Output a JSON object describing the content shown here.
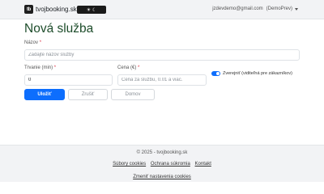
{
  "navbar": {
    "logo_text": "tb",
    "brand": "tvojbooking.sk",
    "theme_toggle_icons": "☀ ☾",
    "user_email": "jzdevdemo@gmail.com",
    "user_role": "(DemoPrev)"
  },
  "page": {
    "title": "Nová služba"
  },
  "form": {
    "name_label": "Názov",
    "name_placeholder": "Zadajte názov služby",
    "name_value": "",
    "duration_label": "Trvanie (min)",
    "duration_value": "0",
    "price_label": "Cena (€)",
    "price_placeholder": "Cena za službu, 0.01 a viac.",
    "price_value": "",
    "required_mark": "*",
    "publish_label": "Zverejniť (viditeľná pre zákazníkov)",
    "publish_checked": true
  },
  "buttons": {
    "save": "Uložiť",
    "cancel": "Zrušiť",
    "home": "Domov"
  },
  "footer": {
    "copyright": "© 2025 - tvojbooking.sk",
    "links": [
      "Súbory cookies",
      "Ochrana súkromia",
      "Kontakt"
    ],
    "cookie_settings": "Zmeniť nastavenia cookies"
  },
  "colors": {
    "accent": "#0d6efd",
    "title": "#1e4d2b",
    "required": "#dc3545"
  }
}
